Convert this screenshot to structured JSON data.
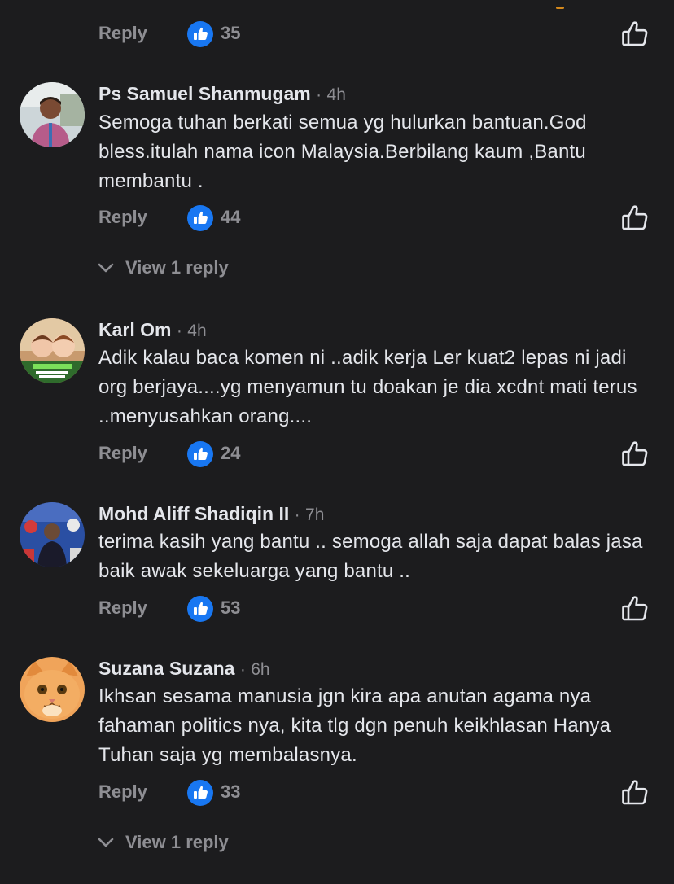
{
  "colors": {
    "background": "#1c1c1e",
    "text_primary": "#e4e6eb",
    "text_secondary": "#8e8e93",
    "like_blue": "#1877f2"
  },
  "icons": {
    "like_badge": "thumbs-up-filled-icon",
    "like_button": "thumbs-up-outline-icon",
    "view_replies": "chevron-down-icon"
  },
  "labels": {
    "reply": "Reply",
    "dot": "·"
  },
  "top_actions": {
    "reply": "Reply",
    "likes": "35"
  },
  "comments": [
    {
      "author": "Ps Samuel Shanmugam",
      "time": "4h",
      "text": "Semoga tuhan berkati semua yg hulurkan bantuan.God bless.itulah nama icon Malaysia.Berbilang kaum ,Bantu membantu .",
      "reply_label": "Reply",
      "likes": "44",
      "view_replies": "View 1 reply"
    },
    {
      "author": "Karl Om",
      "time": "4h",
      "text": "Adik kalau baca komen ni ..adik kerja Ler kuat2 lepas ni jadi org berjaya....yg menyamun tu doakan je dia xcdnt mati terus ..menyusahkan orang....",
      "reply_label": "Reply",
      "likes": "24"
    },
    {
      "author": "Mohd Aliff Shadiqin II",
      "time": "7h",
      "text": "terima kasih yang bantu .. semoga allah saja dapat balas jasa baik awak sekeluarga yang bantu ..",
      "reply_label": "Reply",
      "likes": "53"
    },
    {
      "author": "Suzana Suzana",
      "time": "6h",
      "text": "Ikhsan sesama manusia jgn kira apa anutan agama nya fahaman politics nya, kita tlg dgn penuh keikhlasan Hanya Tuhan saja yg membalasnya.",
      "reply_label": "Reply",
      "likes": "33",
      "view_replies": "View 1 reply"
    }
  ]
}
